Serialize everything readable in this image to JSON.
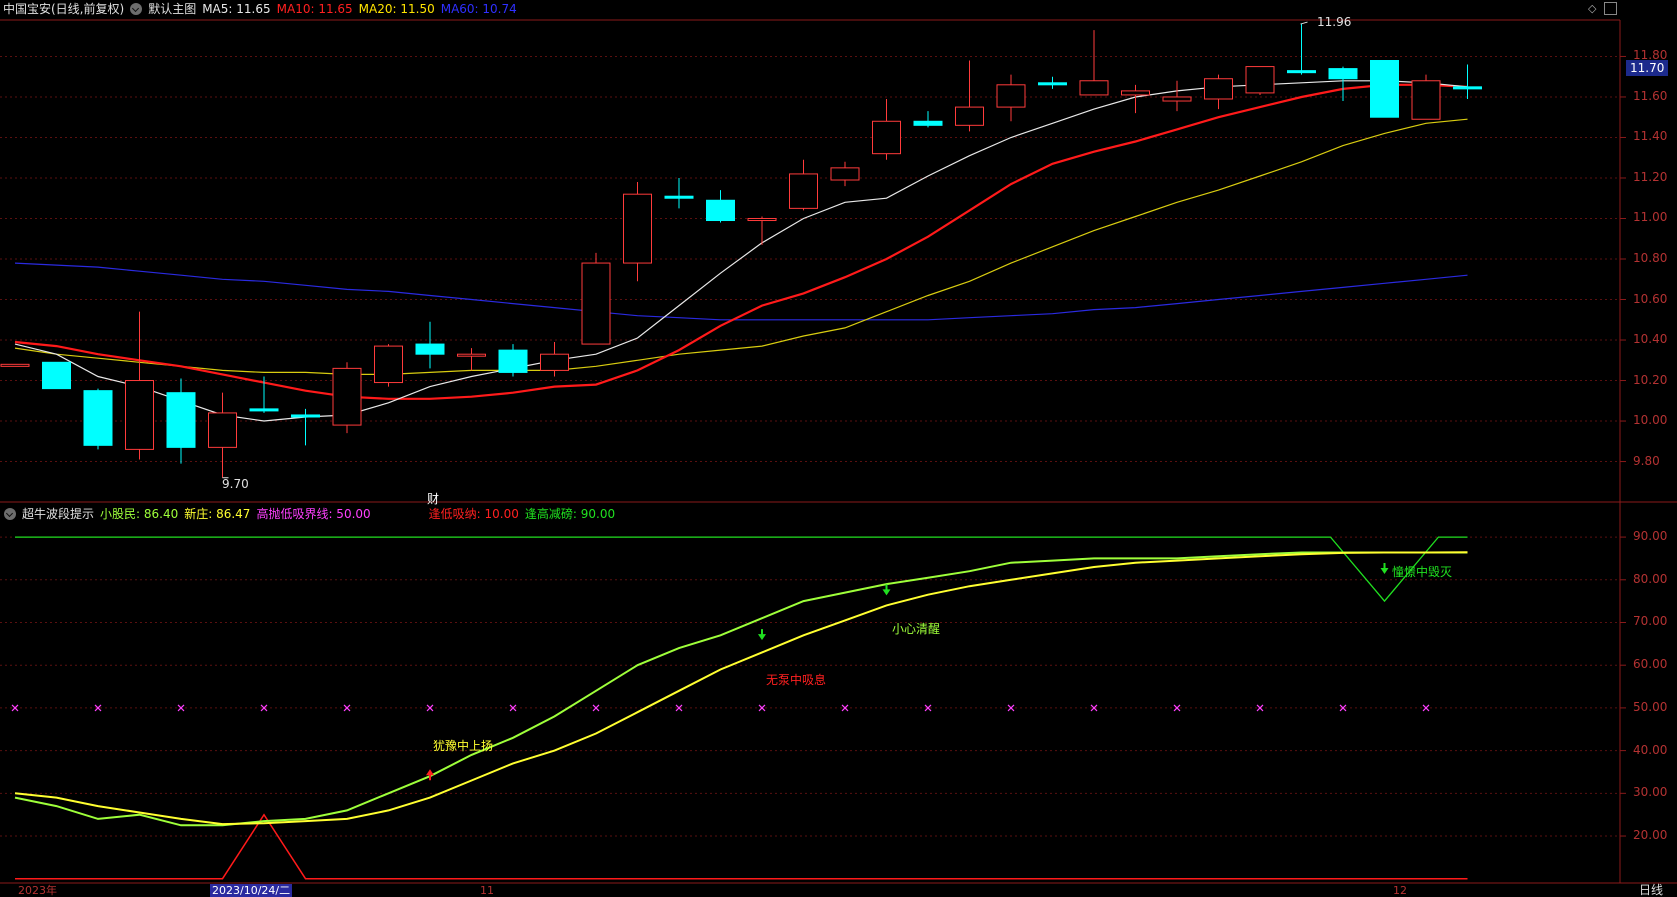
{
  "header": {
    "title": "中国宝安(日线,前复权)",
    "main_chart_label": "默认主图",
    "ma": [
      {
        "label": "MA5: 11.65",
        "color": "#e8e8e8"
      },
      {
        "label": "MA10: 11.65",
        "color": "#ff2020"
      },
      {
        "label": "MA20: 11.50",
        "color": "#ffe400"
      },
      {
        "label": "MA60: 10.74",
        "color": "#2f2fff"
      }
    ]
  },
  "indicator_header": {
    "name": "超牛波段提示",
    "items": [
      {
        "label": "小股民: 86.40",
        "color": "#9eff3a"
      },
      {
        "label": "新庄: 86.47",
        "color": "#ffff30"
      },
      {
        "label": "高抛低吸界线: 50.00",
        "color": "#ff40ff"
      },
      {
        "label": "逢低吸纳: 10.00",
        "color": "#ff2020"
      },
      {
        "label": "逢高减磅: 90.00",
        "color": "#20e020"
      }
    ]
  },
  "price_axis": [
    "11.80",
    "11.60",
    "11.40",
    "11.20",
    "11.00",
    "10.80",
    "10.60",
    "10.40",
    "10.20",
    "10.00",
    "9.80"
  ],
  "current_price": "11.70",
  "high_label": "11.96",
  "low_label": "9.70",
  "finance_marker": "财",
  "ind_axis": [
    "90.00",
    "80.00",
    "70.00",
    "60.00",
    "50.00",
    "40.00",
    "30.00",
    "20.00"
  ],
  "annotations": {
    "a1": "犹豫中上扬",
    "a2": "无泵中吸息",
    "a3": "小心清醒",
    "a4": "憧憬中毁灭"
  },
  "date_axis": {
    "year": "2023年",
    "cursor_date": "2023/10/24/二",
    "m11": "11",
    "m12": "12"
  },
  "period_button": "日线",
  "chart_data": {
    "type": "candlestick",
    "title": "中国宝安(日线,前复权)",
    "ylim": [
      9.62,
      11.98
    ],
    "candles": [
      {
        "o": 10.27,
        "h": 10.28,
        "l": 10.27,
        "c": 10.28
      },
      {
        "o": 10.29,
        "h": 10.29,
        "l": 10.16,
        "c": 10.16
      },
      {
        "o": 10.15,
        "h": 10.16,
        "l": 9.86,
        "c": 9.88
      },
      {
        "o": 9.86,
        "h": 10.54,
        "l": 9.81,
        "c": 10.2
      },
      {
        "o": 10.14,
        "h": 10.21,
        "l": 9.79,
        "c": 9.87
      },
      {
        "o": 9.87,
        "h": 10.14,
        "l": 9.72,
        "c": 10.04
      },
      {
        "o": 10.06,
        "h": 10.22,
        "l": 10.04,
        "c": 10.05
      },
      {
        "o": 10.03,
        "h": 10.06,
        "l": 9.88,
        "c": 10.02
      },
      {
        "o": 9.98,
        "h": 10.29,
        "l": 9.94,
        "c": 10.26
      },
      {
        "o": 10.19,
        "h": 10.38,
        "l": 10.17,
        "c": 10.37
      },
      {
        "o": 10.38,
        "h": 10.49,
        "l": 10.26,
        "c": 10.33
      },
      {
        "o": 10.33,
        "h": 10.36,
        "l": 10.25,
        "c": 10.33
      },
      {
        "o": 10.35,
        "h": 10.38,
        "l": 10.22,
        "c": 10.24
      },
      {
        "o": 10.25,
        "h": 10.39,
        "l": 10.22,
        "c": 10.33
      },
      {
        "o": 10.38,
        "h": 10.83,
        "l": 10.38,
        "c": 10.78
      },
      {
        "o": 10.78,
        "h": 11.18,
        "l": 10.69,
        "c": 11.12
      },
      {
        "o": 11.11,
        "h": 11.2,
        "l": 11.05,
        "c": 11.1
      },
      {
        "o": 11.09,
        "h": 11.14,
        "l": 10.98,
        "c": 10.99
      },
      {
        "o": 10.99,
        "h": 11.01,
        "l": 10.87,
        "c": 11.0
      },
      {
        "o": 11.05,
        "h": 11.29,
        "l": 11.04,
        "c": 11.22
      },
      {
        "o": 11.19,
        "h": 11.28,
        "l": 11.16,
        "c": 11.25
      },
      {
        "o": 11.32,
        "h": 11.59,
        "l": 11.29,
        "c": 11.48
      },
      {
        "o": 11.48,
        "h": 11.53,
        "l": 11.45,
        "c": 11.46
      },
      {
        "o": 11.46,
        "h": 11.78,
        "l": 11.43,
        "c": 11.55
      },
      {
        "o": 11.55,
        "h": 11.71,
        "l": 11.48,
        "c": 11.66
      },
      {
        "o": 11.67,
        "h": 11.7,
        "l": 11.64,
        "c": 11.66
      },
      {
        "o": 11.61,
        "h": 11.93,
        "l": 11.61,
        "c": 11.68
      },
      {
        "o": 11.61,
        "h": 11.66,
        "l": 11.52,
        "c": 11.63
      },
      {
        "o": 11.58,
        "h": 11.68,
        "l": 11.53,
        "c": 11.6
      },
      {
        "o": 11.59,
        "h": 11.71,
        "l": 11.54,
        "c": 11.69
      },
      {
        "o": 11.62,
        "h": 11.75,
        "l": 11.61,
        "c": 11.75
      },
      {
        "o": 11.73,
        "h": 11.96,
        "l": 11.71,
        "c": 11.72
      },
      {
        "o": 11.74,
        "h": 11.75,
        "l": 11.58,
        "c": 11.69
      },
      {
        "o": 11.78,
        "h": 11.78,
        "l": 11.5,
        "c": 11.5
      },
      {
        "o": 11.49,
        "h": 11.71,
        "l": 11.49,
        "c": 11.68
      },
      {
        "o": 11.65,
        "h": 11.76,
        "l": 11.59,
        "c": 11.64
      }
    ],
    "ma5": [
      10.38,
      10.33,
      10.22,
      10.17,
      10.1,
      10.03,
      10.0,
      10.02,
      10.03,
      10.09,
      10.17,
      10.22,
      10.26,
      10.3,
      10.33,
      10.41,
      10.57,
      10.73,
      10.88,
      11.0,
      11.08,
      11.1,
      11.21,
      11.31,
      11.4,
      11.47,
      11.54,
      11.6,
      11.63,
      11.65,
      11.66,
      11.67,
      11.68,
      11.68,
      11.67,
      11.65
    ],
    "ma10": [
      10.39,
      10.37,
      10.33,
      10.3,
      10.27,
      10.23,
      10.19,
      10.15,
      10.12,
      10.11,
      10.11,
      10.12,
      10.14,
      10.17,
      10.18,
      10.25,
      10.35,
      10.47,
      10.57,
      10.63,
      10.71,
      10.8,
      10.91,
      11.04,
      11.17,
      11.27,
      11.33,
      11.38,
      11.44,
      11.5,
      11.55,
      11.6,
      11.64,
      11.66,
      11.66,
      11.65
    ],
    "ma20": [
      10.36,
      10.33,
      10.31,
      10.29,
      10.27,
      10.25,
      10.24,
      10.24,
      10.23,
      10.23,
      10.24,
      10.25,
      10.25,
      10.25,
      10.27,
      10.3,
      10.33,
      10.35,
      10.37,
      10.42,
      10.46,
      10.54,
      10.62,
      10.69,
      10.78,
      10.86,
      10.94,
      11.01,
      11.08,
      11.14,
      11.21,
      11.28,
      11.36,
      11.42,
      11.47,
      11.49
    ],
    "ma60": [
      10.78,
      10.77,
      10.76,
      10.74,
      10.72,
      10.7,
      10.69,
      10.67,
      10.65,
      10.64,
      10.62,
      10.6,
      10.58,
      10.56,
      10.54,
      10.52,
      10.51,
      10.5,
      10.5,
      10.5,
      10.5,
      10.5,
      10.5,
      10.51,
      10.52,
      10.53,
      10.55,
      10.56,
      10.58,
      10.6,
      10.62,
      10.64,
      10.66,
      10.68,
      10.7,
      10.72
    ],
    "indicator": {
      "ylim": [
        9,
        94
      ],
      "xiao_gumin": [
        29,
        27,
        24,
        25,
        22.5,
        22.5,
        23.5,
        24,
        26,
        30,
        34,
        39,
        43,
        48,
        54,
        60,
        64,
        67,
        71,
        75,
        77,
        79,
        80.5,
        82,
        84,
        84.5,
        85,
        85,
        85,
        85.5,
        86,
        86.4,
        86.4,
        86.4,
        86.4,
        86.4
      ],
      "xin_zhuang": [
        30,
        29,
        27,
        25.5,
        24,
        22.8,
        23,
        23.5,
        24,
        26,
        29,
        33,
        37,
        40,
        44,
        49,
        54,
        59,
        63,
        67,
        70.5,
        74,
        76.5,
        78.5,
        80,
        81.5,
        83,
        84,
        84.5,
        85,
        85.5,
        86,
        86.3,
        86.4,
        86.4,
        86.47
      ],
      "low_line_spike_x": 6,
      "low_line_spike_value": 25,
      "high_line_dip_x": 33,
      "high_line_dip_value": 75,
      "threshold": 50,
      "low_buy": 10,
      "high_sell": 90
    }
  }
}
